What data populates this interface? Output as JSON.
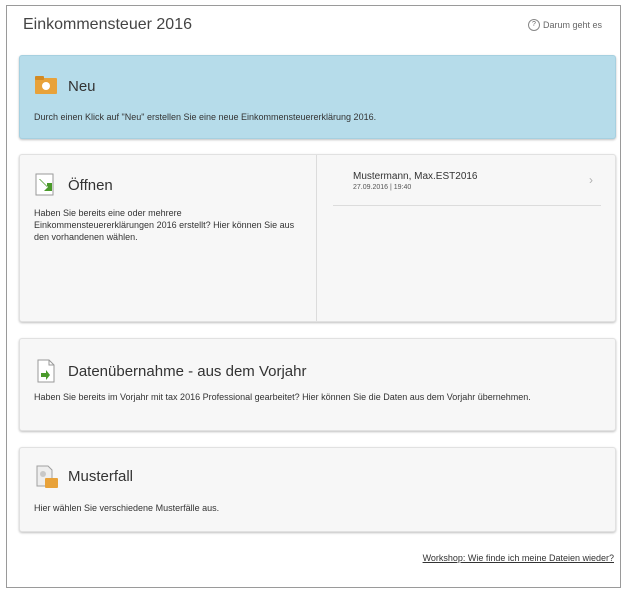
{
  "header": {
    "title": "Einkommensteuer 2016",
    "help_label": "Darum geht es"
  },
  "cards": {
    "neu": {
      "title": "Neu",
      "description": "Durch einen Klick auf \"Neu\" erstellen Sie eine neue Einkommensteuererklärung 2016."
    },
    "oeffnen": {
      "title": "Öffnen",
      "description": "Haben Sie bereits eine oder mehrere Einkommensteuererklärungen 2016 erstellt? Hier können Sie aus den vorhandenen wählen.",
      "files": [
        {
          "name": "Mustermann, Max.EST2016",
          "date": "27.09.2016 | 19:40"
        }
      ]
    },
    "datenuebernahme": {
      "title": "Datenübernahme - aus dem Vorjahr",
      "description": "Haben Sie bereits im Vorjahr mit tax 2016 Professional gearbeitet? Hier können Sie die Daten aus dem Vorjahr übernehmen."
    },
    "musterfall": {
      "title": "Musterfall",
      "description": "Hier wählen Sie verschiedene Musterfälle aus."
    }
  },
  "footer": {
    "workshop_link": "Workshop: Wie finde ich meine Dateien wieder?"
  },
  "icons": {
    "neu": "folder-icon",
    "oeffnen": "open-file-icon",
    "datenuebernahme": "import-file-icon",
    "musterfall": "sample-case-icon"
  },
  "colors": {
    "neu_card_bg": "#b6dcea",
    "card_bg": "#f7f7f7",
    "folder": "#e8a23a",
    "green_arrow": "#4a9a2a"
  }
}
